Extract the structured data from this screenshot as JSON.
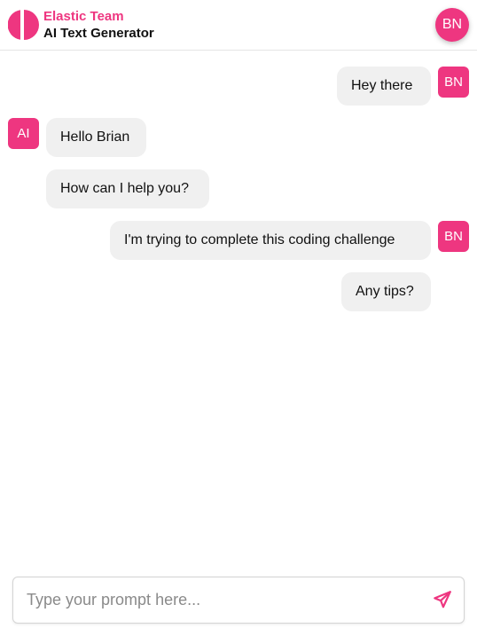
{
  "header": {
    "team_name": "Elastic Team",
    "app_name": "AI Text Generator",
    "user_initials": "BN",
    "logo_icon": "half-circle-logo-icon"
  },
  "colors": {
    "accent": "#ee3680",
    "bubble_bg": "#f0f0f0",
    "text": "#111111",
    "placeholder": "#8a8a8a",
    "divider": "#e5e5e5"
  },
  "messages": [
    {
      "sender": "user",
      "avatar": "BN",
      "text": "Hey there"
    },
    {
      "sender": "ai",
      "avatar": "AI",
      "text": "Hello Brian"
    },
    {
      "sender": "ai",
      "avatar": "",
      "text": "How can I help you?"
    },
    {
      "sender": "user",
      "avatar": "BN",
      "text": "I'm trying to complete this coding challenge"
    },
    {
      "sender": "user",
      "avatar": "",
      "text": "Any tips?"
    }
  ],
  "composer": {
    "value": "",
    "placeholder": "Type your prompt here...",
    "send_icon": "paper-plane-send-icon"
  }
}
